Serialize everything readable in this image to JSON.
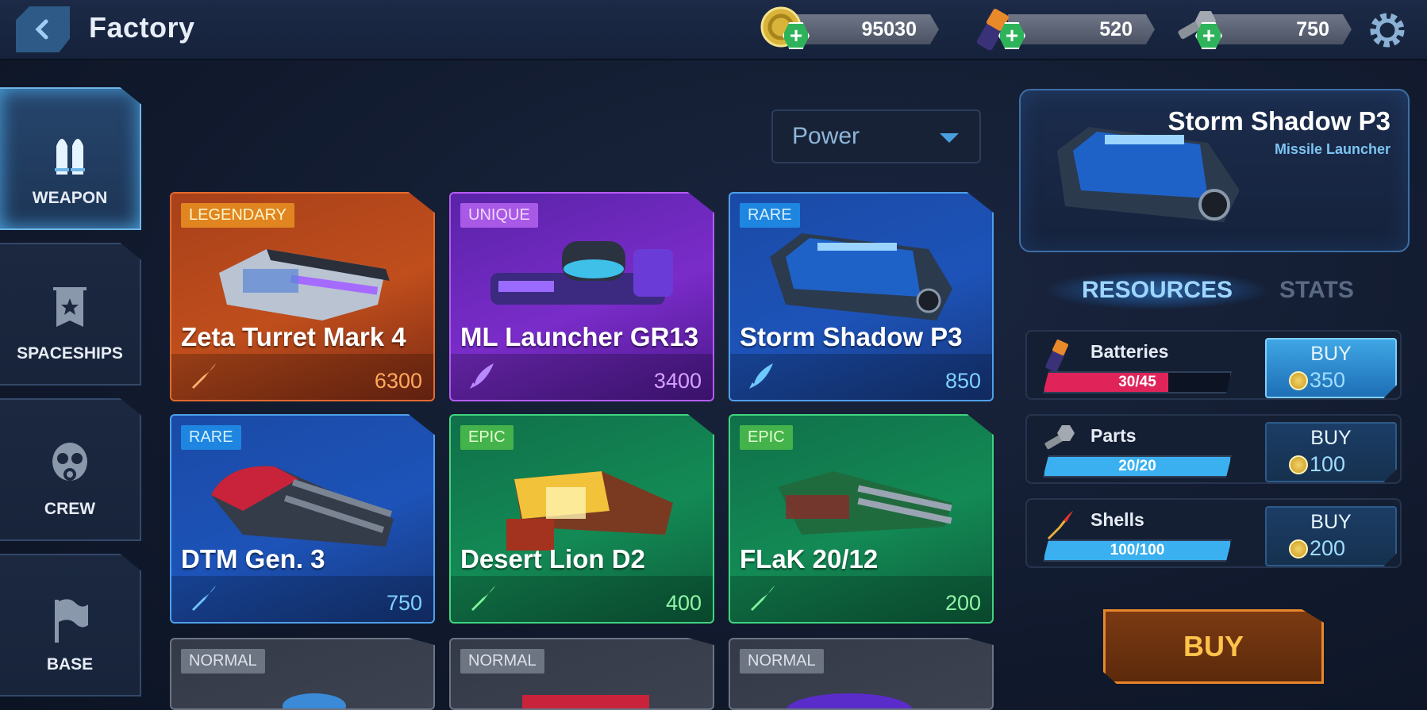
{
  "header": {
    "title": "Factory",
    "currencies": [
      {
        "name": "coins",
        "value": "95030"
      },
      {
        "name": "batteries",
        "value": "520"
      },
      {
        "name": "parts",
        "value": "750"
      }
    ]
  },
  "sidebar": {
    "items": [
      {
        "label": "WEAPON",
        "icon": "bullets-icon",
        "active": true
      },
      {
        "label": "SPACESHIPS",
        "icon": "banner-star-icon",
        "active": false
      },
      {
        "label": "CREW",
        "icon": "gas-mask-icon",
        "active": false
      },
      {
        "label": "BASE",
        "icon": "flag-icon",
        "active": false
      }
    ]
  },
  "sort": {
    "selected": "Power"
  },
  "cards": [
    {
      "rarity": "LEGENDARY",
      "name": "Zeta Turret Mark 4",
      "price": "6300",
      "type": "bullet-icon",
      "color": "orange"
    },
    {
      "rarity": "UNIQUE",
      "name": "ML Launcher GR13",
      "price": "3400",
      "type": "rocket-icon",
      "color": "purple"
    },
    {
      "rarity": "RARE",
      "name": "Storm Shadow P3",
      "price": "850",
      "type": "rocket-icon",
      "color": "blue"
    },
    {
      "rarity": "RARE",
      "name": "DTM Gen. 3",
      "price": "750",
      "type": "bullet-icon",
      "color": "blue"
    },
    {
      "rarity": "EPIC",
      "name": "Desert Lion D2",
      "price": "400",
      "type": "bullet-icon",
      "color": "green"
    },
    {
      "rarity": "EPIC",
      "name": "FLaK 20/12",
      "price": "200",
      "type": "bullet-icon",
      "color": "green"
    },
    {
      "rarity": "NORMAL",
      "name": "",
      "price": "",
      "color": "gray"
    },
    {
      "rarity": "NORMAL",
      "name": "",
      "price": "",
      "color": "gray"
    },
    {
      "rarity": "NORMAL",
      "name": "",
      "price": "",
      "color": "gray"
    }
  ],
  "detail": {
    "name": "Storm Shadow P3",
    "type": "Missile Launcher"
  },
  "tabs": {
    "resources": "RESOURCES",
    "stats": "STATS"
  },
  "resources": [
    {
      "name": "Batteries",
      "progress": "30/45",
      "fraction": 0.667,
      "buy": "BUY",
      "cost": "350",
      "fill_color": "#e0245a",
      "active": true
    },
    {
      "name": "Parts",
      "progress": "20/20",
      "fraction": 1.0,
      "buy": "BUY",
      "cost": "100",
      "fill_color": "#3ab0f0",
      "active": false
    },
    {
      "name": "Shells",
      "progress": "100/100",
      "fraction": 1.0,
      "buy": "BUY",
      "cost": "200",
      "fill_color": "#3ab0f0",
      "active": false
    }
  ],
  "buy_button": "BUY"
}
